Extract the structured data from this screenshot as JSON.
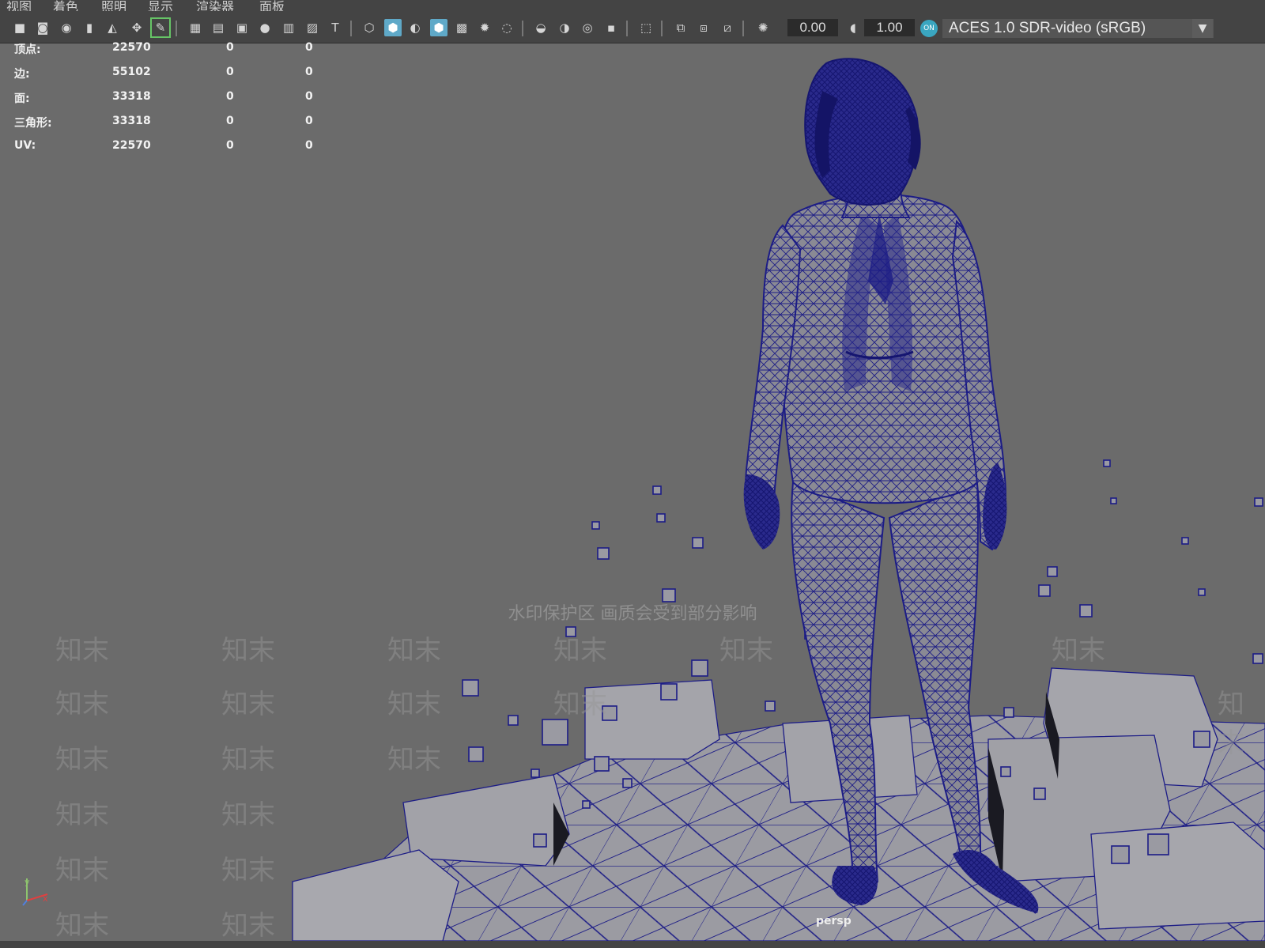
{
  "menu": [
    "视图",
    "着色",
    "照明",
    "显示",
    "渲染器",
    "面板"
  ],
  "toolbar": {
    "icons": [
      "camera-icon",
      "camera-lock-icon",
      "camera-bookmark-icon",
      "bookmark-icon",
      "image-plane-icon",
      "grid-snap-icon",
      "paint-tool-icon",
      "grid-icon",
      "film-gate-icon",
      "resolution-gate-icon",
      "gate-mask-icon",
      "field-chart-icon",
      "safe-action-icon",
      "safe-title-icon",
      "wireframe-icon",
      "smooth-shade-icon",
      "shade-wireframe-icon",
      "xray-icon",
      "textured-icon",
      "lights-icon",
      "shadows-icon",
      "ambient-occlusion-icon",
      "motion-blur-icon",
      "antialias-icon",
      "depth-of-field-icon",
      "isolate-select-icon",
      "xray-joints-icon",
      "xray-active-icon",
      "backface-icon",
      "exposure-icon",
      "gamma-icon"
    ],
    "exposure": "0.00",
    "gamma": "1.00",
    "color_space_toggle": "ON",
    "color_space": "ACES 1.0 SDR-video (sRGB)"
  },
  "hud": {
    "rows": [
      {
        "label": "顶点:",
        "value": "22570",
        "c2": "0",
        "c3": "0"
      },
      {
        "label": "边:",
        "value": "55102",
        "c2": "0",
        "c3": "0"
      },
      {
        "label": "面:",
        "value": "33318",
        "c2": "0",
        "c3": "0"
      },
      {
        "label": "三角形:",
        "value": "33318",
        "c2": "0",
        "c3": "0"
      },
      {
        "label": "UV:",
        "value": "22570",
        "c2": "0",
        "c3": "0"
      }
    ]
  },
  "watermark": {
    "banner": "水印保护区  画质会受到部分影响",
    "tile": "知末"
  },
  "viewport": {
    "camera": "persp",
    "axis_y": "y",
    "axis_x": "x"
  },
  "colors": {
    "wire": "#1c1c86",
    "background": "#6b6b6b",
    "cube_face": "#a9a9ae",
    "accent": "#5fa9c8"
  }
}
